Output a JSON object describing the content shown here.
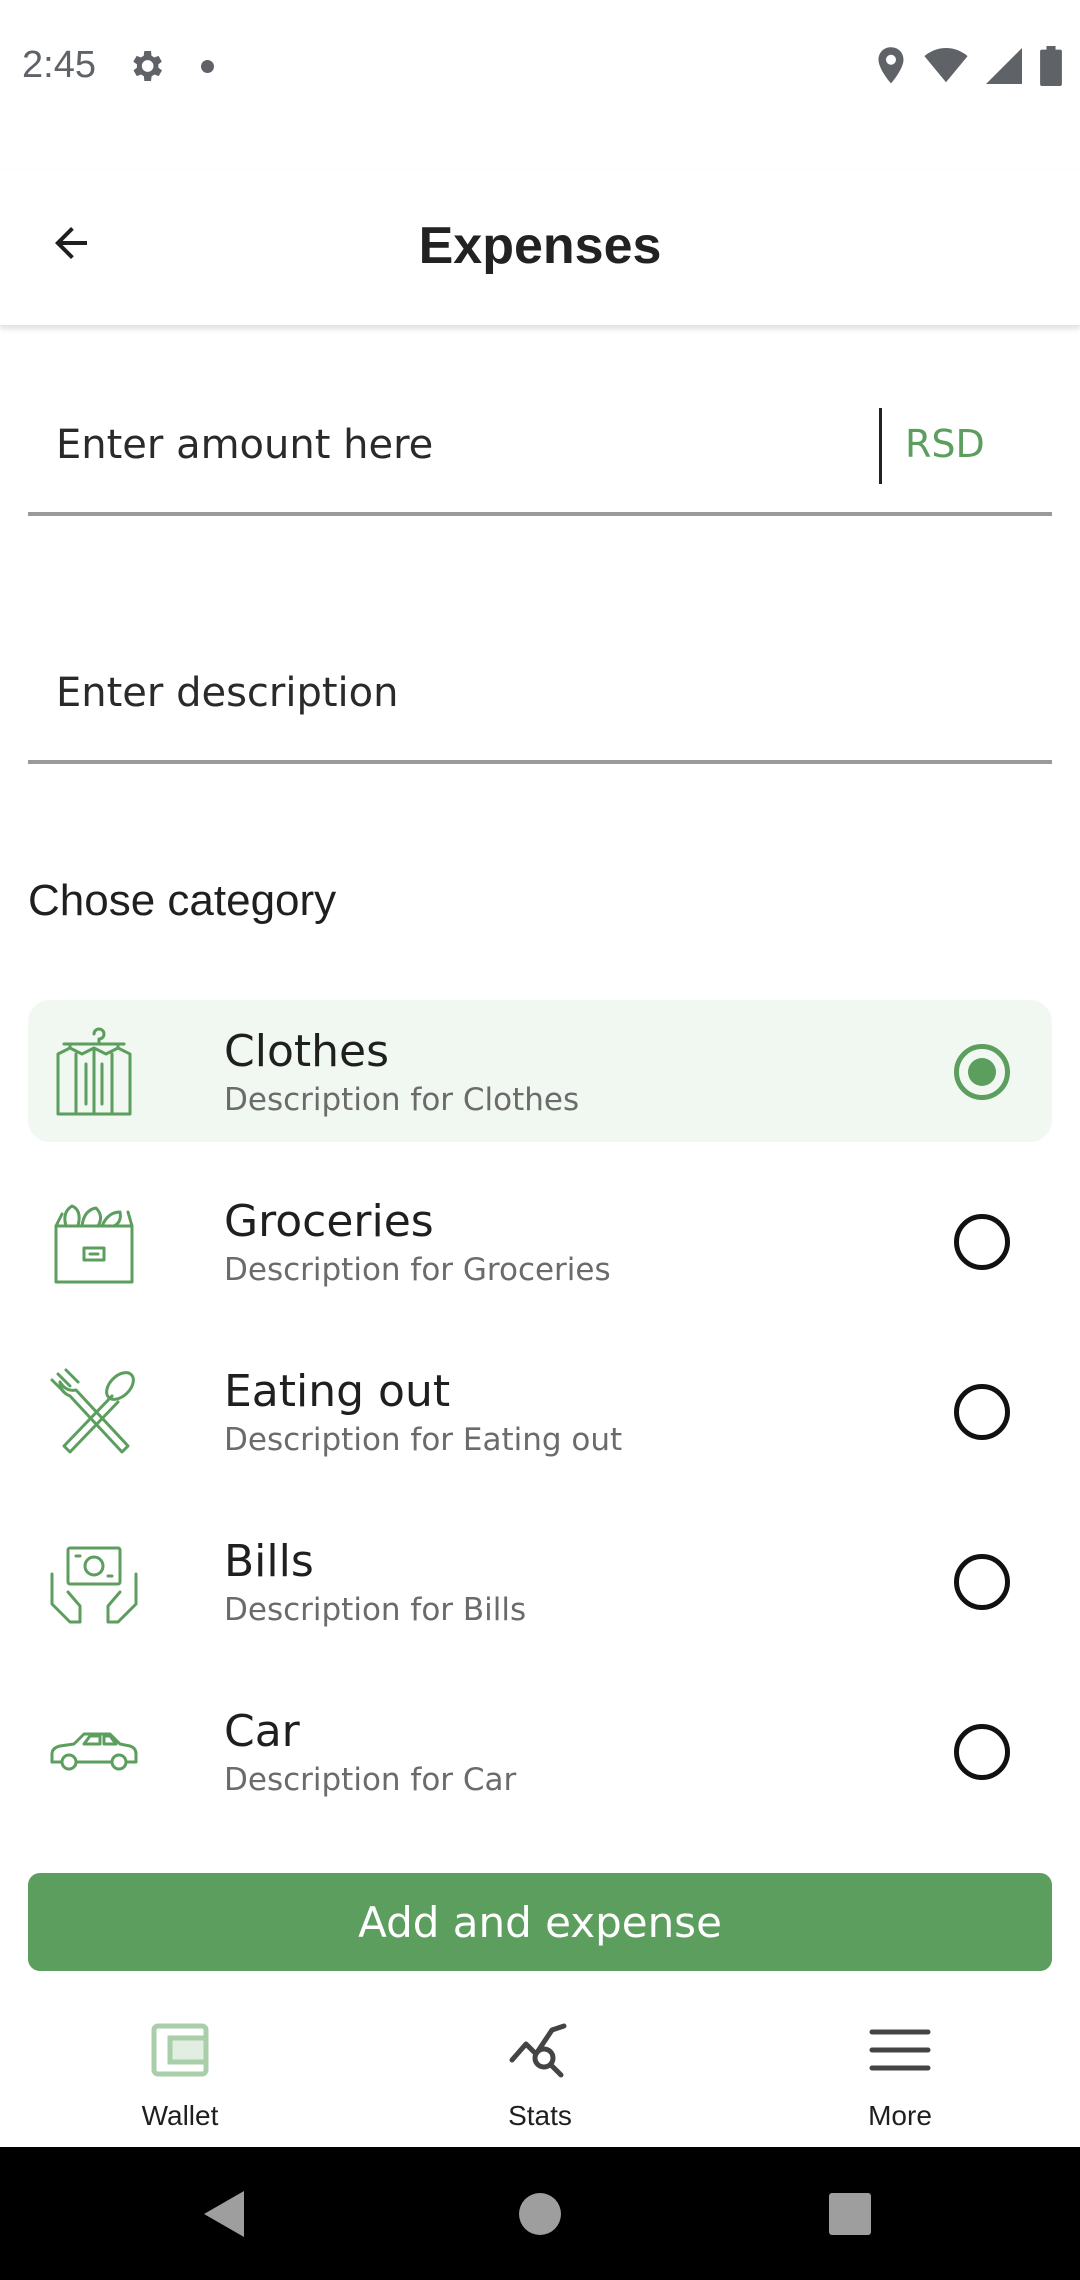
{
  "status_bar": {
    "time": "2:45"
  },
  "app_bar": {
    "title": "Expenses"
  },
  "amount_field": {
    "placeholder": "Enter amount here",
    "currency": "RSD"
  },
  "description_field": {
    "placeholder": "Enter description"
  },
  "category_section": {
    "title": "Chose category",
    "items": [
      {
        "name": "Clothes",
        "description": "Description for Clothes",
        "icon": "clothes-icon",
        "selected": true
      },
      {
        "name": "Groceries",
        "description": "Description for Groceries",
        "icon": "groceries-icon",
        "selected": false
      },
      {
        "name": "Eating out",
        "description": "Description for Eating out",
        "icon": "eating-out-icon",
        "selected": false
      },
      {
        "name": "Bills",
        "description": "Description for Bills",
        "icon": "bills-icon",
        "selected": false
      },
      {
        "name": "Car",
        "description": "Description for Car",
        "icon": "car-icon",
        "selected": false
      }
    ]
  },
  "add_button": {
    "label": "Add and expense"
  },
  "bottom_nav": {
    "items": [
      {
        "label": "Wallet",
        "icon": "wallet-icon"
      },
      {
        "label": "Stats",
        "icon": "stats-icon"
      },
      {
        "label": "More",
        "icon": "menu-icon"
      }
    ]
  },
  "colors": {
    "accent": "#5c9e5e",
    "selected_bg": "#f1f7f1"
  }
}
